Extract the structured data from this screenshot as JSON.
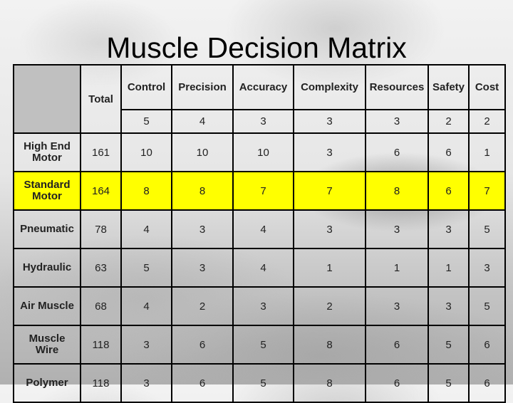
{
  "title": "Muscle Decision Matrix",
  "table": {
    "columns": [
      "Total",
      "Control",
      "Precision",
      "Accuracy",
      "Complexity",
      "Resources",
      "Safety",
      "Cost"
    ],
    "weights": [
      "5",
      "4",
      "3",
      "3",
      "3",
      "2",
      "2"
    ],
    "highlight_color": "#ffff00",
    "rows": [
      {
        "label": "High End Motor",
        "label_lines": [
          "High End",
          "Motor"
        ],
        "total": "161",
        "scores": [
          "10",
          "10",
          "10",
          "3",
          "6",
          "6",
          "1"
        ],
        "highlighted": false
      },
      {
        "label": "Standard Motor",
        "label_lines": [
          "Standard",
          "Motor"
        ],
        "total": "164",
        "scores": [
          "8",
          "8",
          "7",
          "7",
          "8",
          "6",
          "7"
        ],
        "highlighted": true
      },
      {
        "label": "Pneumatic",
        "label_lines": [
          "Pneumatic"
        ],
        "total": "78",
        "scores": [
          "4",
          "3",
          "4",
          "3",
          "3",
          "3",
          "5"
        ],
        "highlighted": false
      },
      {
        "label": "Hydraulic",
        "label_lines": [
          "Hydraulic"
        ],
        "total": "63",
        "scores": [
          "5",
          "3",
          "4",
          "1",
          "1",
          "1",
          "3"
        ],
        "highlighted": false
      },
      {
        "label": "Air Muscle",
        "label_lines": [
          "Air Muscle"
        ],
        "total": "68",
        "scores": [
          "4",
          "2",
          "3",
          "2",
          "3",
          "3",
          "5"
        ],
        "highlighted": false
      },
      {
        "label": "Muscle Wire",
        "label_lines": [
          "Muscle",
          "Wire"
        ],
        "total": "118",
        "scores": [
          "3",
          "6",
          "5",
          "8",
          "6",
          "5",
          "6"
        ],
        "highlighted": false
      },
      {
        "label": "Polymer",
        "label_lines": [
          "Polymer"
        ],
        "total": "118",
        "scores": [
          "3",
          "6",
          "5",
          "8",
          "6",
          "5",
          "6"
        ],
        "highlighted": false
      }
    ]
  }
}
